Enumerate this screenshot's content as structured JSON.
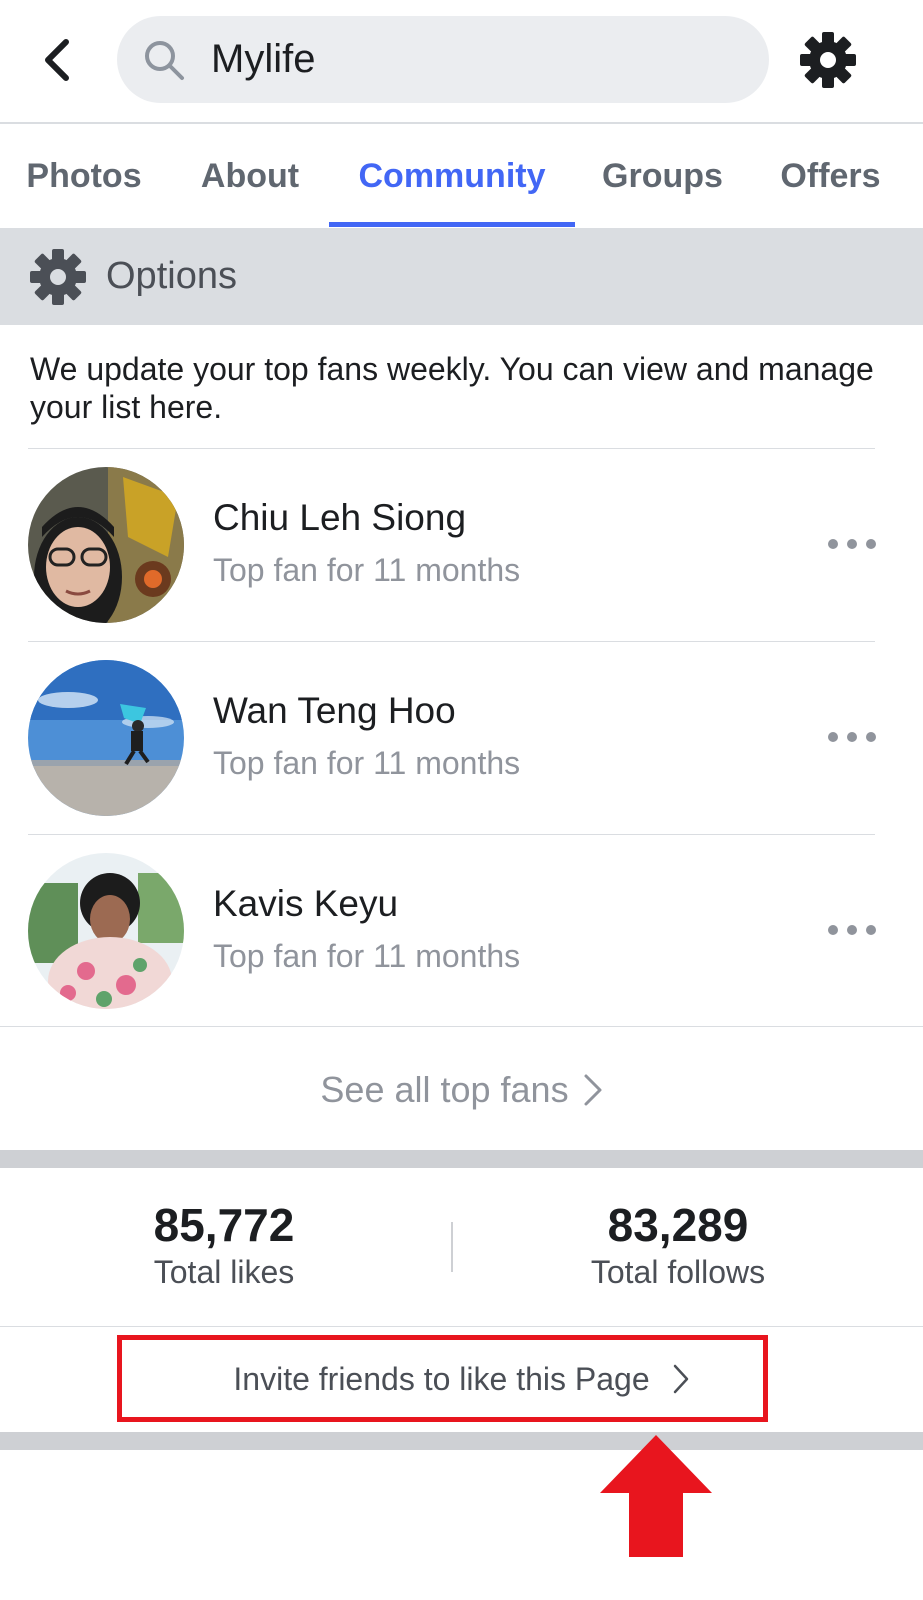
{
  "header": {
    "search_value": "Mylife",
    "icons": {
      "back": "chevron-left-icon",
      "search": "search-icon",
      "settings": "gear-icon"
    }
  },
  "tabs": [
    {
      "label": "Photos",
      "active": false
    },
    {
      "label": "About",
      "active": false
    },
    {
      "label": "Community",
      "active": true
    },
    {
      "label": "Groups",
      "active": false
    },
    {
      "label": "Offers",
      "active": false
    }
  ],
  "options": {
    "label": "Options"
  },
  "top_fans": {
    "description": "We update your top fans weekly. You can view and manage your list here.",
    "fans": [
      {
        "name": "Chiu Leh Siong",
        "subtitle": "Top fan for 11 months"
      },
      {
        "name": "Wan Teng Hoo",
        "subtitle": "Top fan for 11 months"
      },
      {
        "name": "Kavis Keyu",
        "subtitle": "Top fan for 11 months"
      }
    ],
    "see_all_label": "See all top fans"
  },
  "stats": {
    "likes": {
      "value": "85,772",
      "label": "Total likes"
    },
    "follows": {
      "value": "83,289",
      "label": "Total follows"
    }
  },
  "invite": {
    "label": "Invite friends to like this Page"
  },
  "colors": {
    "accent": "#4267f5",
    "annotation": "#e8151e",
    "muted_text": "#90949c",
    "separator": "#ced0d4"
  }
}
